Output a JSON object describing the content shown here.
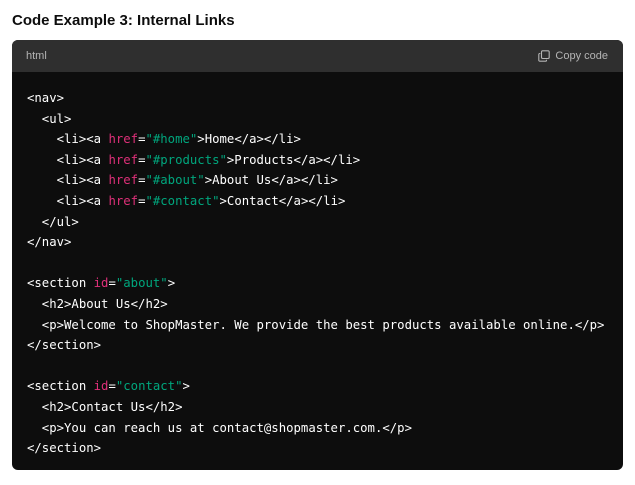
{
  "heading": "Code Example 3: Internal Links",
  "code_block": {
    "language": "html",
    "copy_label": "Copy code",
    "colors": {
      "attr": "#df3079",
      "string": "#00a67d",
      "text": "#ffffff",
      "background": "#0d0d0d",
      "header": "#2f2f2f"
    },
    "lines": [
      [
        {
          "t": "<nav>"
        }
      ],
      [
        {
          "t": "  <ul>"
        }
      ],
      [
        {
          "t": "    <li><a "
        },
        {
          "t": "href",
          "c": "attr"
        },
        {
          "t": "="
        },
        {
          "t": "\"#home\"",
          "c": "str"
        },
        {
          "t": ">Home</a></li>"
        }
      ],
      [
        {
          "t": "    <li><a "
        },
        {
          "t": "href",
          "c": "attr"
        },
        {
          "t": "="
        },
        {
          "t": "\"#products\"",
          "c": "str"
        },
        {
          "t": ">Products</a></li>"
        }
      ],
      [
        {
          "t": "    <li><a "
        },
        {
          "t": "href",
          "c": "attr"
        },
        {
          "t": "="
        },
        {
          "t": "\"#about\"",
          "c": "str"
        },
        {
          "t": ">About Us</a></li>"
        }
      ],
      [
        {
          "t": "    <li><a "
        },
        {
          "t": "href",
          "c": "attr"
        },
        {
          "t": "="
        },
        {
          "t": "\"#contact\"",
          "c": "str"
        },
        {
          "t": ">Contact</a></li>"
        }
      ],
      [
        {
          "t": "  </ul>"
        }
      ],
      [
        {
          "t": "</nav>"
        }
      ],
      [
        {
          "t": ""
        }
      ],
      [
        {
          "t": "<section "
        },
        {
          "t": "id",
          "c": "attr"
        },
        {
          "t": "="
        },
        {
          "t": "\"about\"",
          "c": "str"
        },
        {
          "t": ">"
        }
      ],
      [
        {
          "t": "  <h2>About Us</h2>"
        }
      ],
      [
        {
          "t": "  <p>Welcome to ShopMaster. We provide the best products available online.</p>"
        }
      ],
      [
        {
          "t": "</section>"
        }
      ],
      [
        {
          "t": ""
        }
      ],
      [
        {
          "t": "<section "
        },
        {
          "t": "id",
          "c": "attr"
        },
        {
          "t": "="
        },
        {
          "t": "\"contact\"",
          "c": "str"
        },
        {
          "t": ">"
        }
      ],
      [
        {
          "t": "  <h2>Contact Us</h2>"
        }
      ],
      [
        {
          "t": "  <p>You can reach us at contact@shopmaster.com.</p>"
        }
      ],
      [
        {
          "t": "</section>"
        }
      ]
    ]
  }
}
